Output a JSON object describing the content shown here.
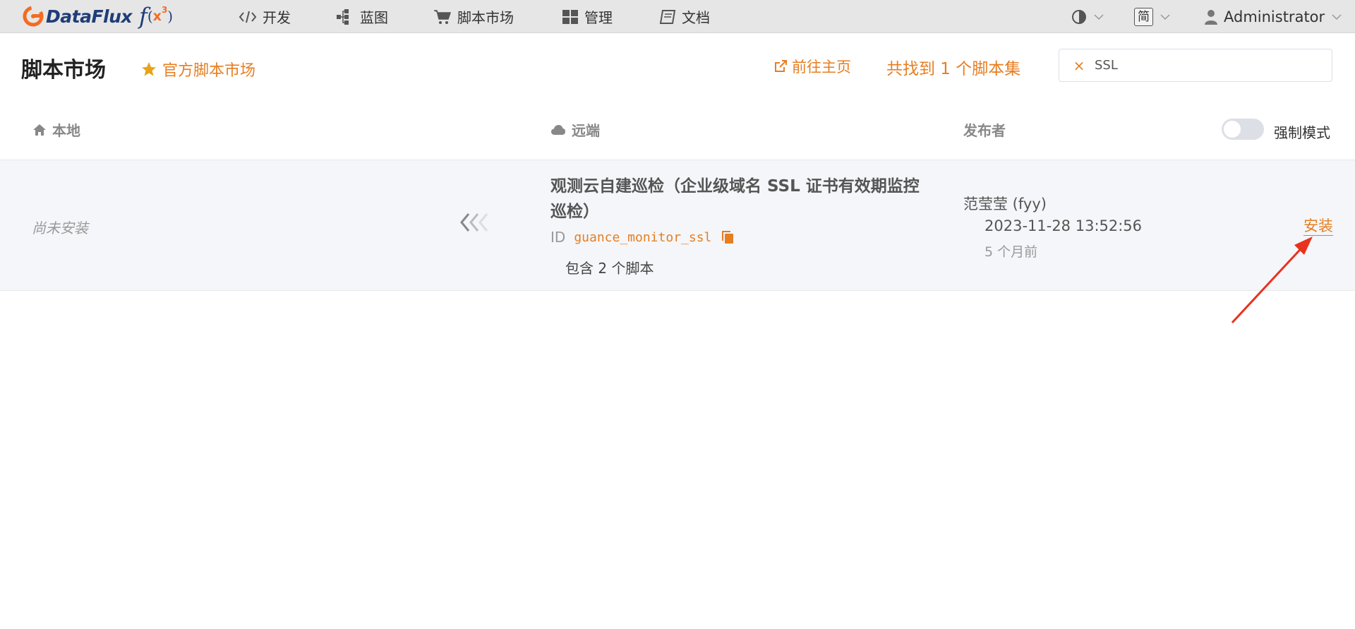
{
  "app": {
    "name": "DataFlux",
    "fx": "f",
    "fx_paren_open": "(",
    "fx_x": "x",
    "fx_sup": "3",
    "fx_paren_close": ")"
  },
  "nav": {
    "items": [
      {
        "label": "开发",
        "icon": "code-icon"
      },
      {
        "label": "蓝图",
        "icon": "blueprint-icon"
      },
      {
        "label": "脚本市场",
        "icon": "cart-icon"
      },
      {
        "label": "管理",
        "icon": "grid-icon"
      },
      {
        "label": "文档",
        "icon": "book-icon"
      }
    ]
  },
  "topright": {
    "lang": "简",
    "user": "Administrator"
  },
  "page": {
    "title": "脚本市场",
    "official_link": "官方脚本市场",
    "goto_home": "前往主页",
    "found_text": "共找到 1 个脚本集"
  },
  "search": {
    "clear": "×",
    "value": "SSL"
  },
  "table": {
    "col_local": "本地",
    "col_remote": "远端",
    "col_publisher": "发布者",
    "force_mode_label": "强制模式",
    "force_mode_on": false
  },
  "rows": [
    {
      "local_status": "尚未安装",
      "title": "观测云自建巡检（企业级域名 SSL 证书有效期监控巡检）",
      "id_label": "ID",
      "id": "guance_monitor_ssl",
      "contains": "包含 2 个脚本",
      "publisher": "范莹莹 (fyy)",
      "time": "2023-11-28 13:52:56",
      "ago": "5 个月前",
      "action": "安装"
    }
  ],
  "colors": {
    "accent": "#e67e22",
    "topbar": "#e6e6e6",
    "row_bg": "#f4f6f9",
    "annotation": "#e8321e"
  }
}
